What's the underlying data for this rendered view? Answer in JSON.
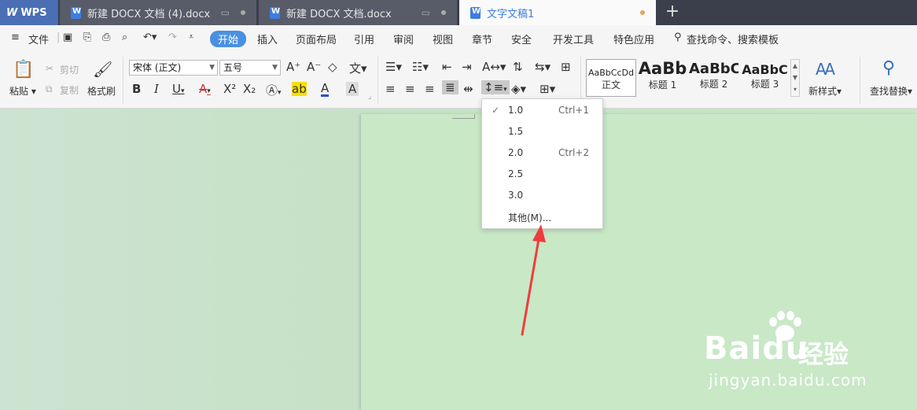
{
  "tabs": {
    "wps_label": "WPS",
    "doc1": "新建 DOCX 文档 (4).docx",
    "doc2": "新建 DOCX 文档.docx",
    "doc3": "文字文稿1",
    "new_tab": "+"
  },
  "menu": {
    "file": "文件",
    "items": [
      "开始",
      "插入",
      "页面布局",
      "引用",
      "审阅",
      "视图",
      "章节",
      "安全",
      "开发工具",
      "特色应用"
    ],
    "search": "查找命令、搜索模板"
  },
  "ribbon": {
    "paste": "粘贴",
    "cut": "剪切",
    "copy": "复制",
    "format_painter": "格式刷",
    "font_name": "宋体 (正文)",
    "font_size": "五号",
    "phonetic_glyph": "文",
    "bold": "B",
    "italic": "I",
    "underline": "U",
    "styles": [
      {
        "sample": "AaBbCcDd",
        "name": "正文"
      },
      {
        "sample": "AaBb",
        "name": "标题 1"
      },
      {
        "sample": "AaBbC",
        "name": "标题 2"
      },
      {
        "sample": "AaBbC",
        "name": "标题 3"
      }
    ],
    "new_style": "新样式",
    "find_replace": "查找替换"
  },
  "line_spacing_menu": {
    "items": [
      {
        "value": "1.0",
        "shortcut": "Ctrl+1",
        "checked": true
      },
      {
        "value": "1.5",
        "shortcut": "",
        "checked": false
      },
      {
        "value": "2.0",
        "shortcut": "Ctrl+2",
        "checked": false
      },
      {
        "value": "2.5",
        "shortcut": "",
        "checked": false
      },
      {
        "value": "3.0",
        "shortcut": "",
        "checked": false
      },
      {
        "value": "其他(M)...",
        "shortcut": "",
        "checked": false
      }
    ]
  },
  "watermark": {
    "brand": "Baidu",
    "brand_cn": "经验",
    "url": "jingyan.baidu.com"
  },
  "colors": {
    "accent": "#4a90e2",
    "tabbar": "#3a3f4b",
    "annotation_arrow": "#f03c3c",
    "workspace": "#c8e6c6"
  }
}
